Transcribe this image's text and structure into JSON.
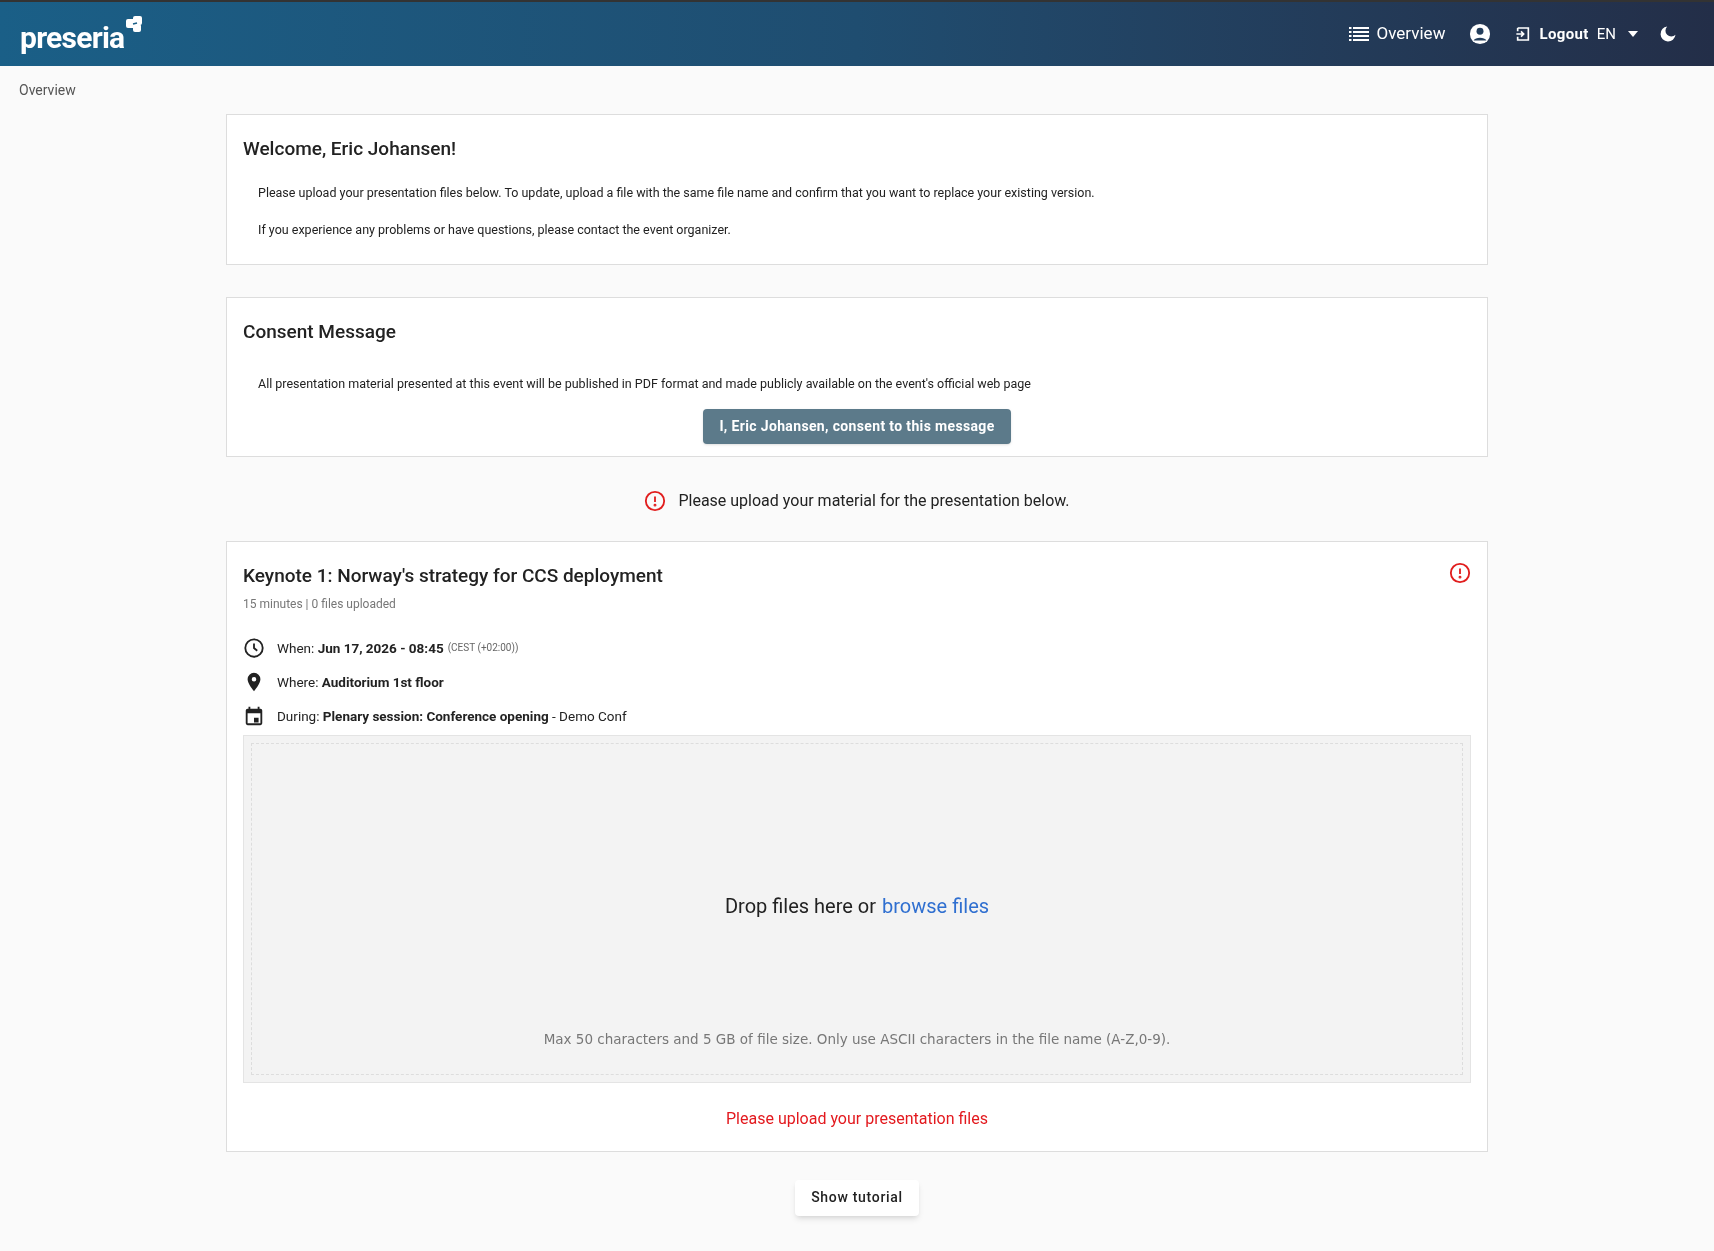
{
  "header": {
    "logo": "preseria",
    "nav": [
      {
        "kind": "overview",
        "label": "Overview"
      },
      {
        "kind": "account"
      },
      {
        "kind": "logout",
        "label": "Logout"
      },
      {
        "kind": "language",
        "label": "EN"
      },
      {
        "kind": "theme"
      }
    ]
  },
  "breadcrumb": "Overview",
  "welcome": {
    "title": "Welcome, Eric Johansen!",
    "paragraphs": [
      "Please upload your presentation files below. To update, upload a file with the same file name and confirm that you want to replace your existing version.",
      "If you experience any problems or have questions, please contact the event organizer."
    ]
  },
  "consent": {
    "title": "Consent Message",
    "text": "All presentation material presented at this event will be published in PDF format and made publicly available on the event's official web page",
    "button": "I, Eric Johansen, consent to this message"
  },
  "notice": "Please upload your material for the presentation below.",
  "presentation": {
    "title": "Keynote 1: Norway's strategy for CCS deployment",
    "meta": "15 minutes | 0 files uploaded",
    "warning": true,
    "details": [
      {
        "kind": "when",
        "text": "When: **Jun 17, 2026 - 08:45**",
        "note": "(CEST (+02:00))"
      },
      {
        "kind": "where",
        "text": "Where: **Auditorium 1st floor**"
      },
      {
        "kind": "during",
        "text": "During: **Plenary session: Conference opening** - Demo Conf"
      }
    ],
    "dropzone": {
      "text": "Drop files here or",
      "link": "browse files",
      "hint": "Max 50 characters and 5 GB of file size. Only use ASCII characters in the file name (A-Z,0-9)."
    },
    "error": "Please upload your presentation files"
  },
  "tutorial_button": "Show tutorial"
}
